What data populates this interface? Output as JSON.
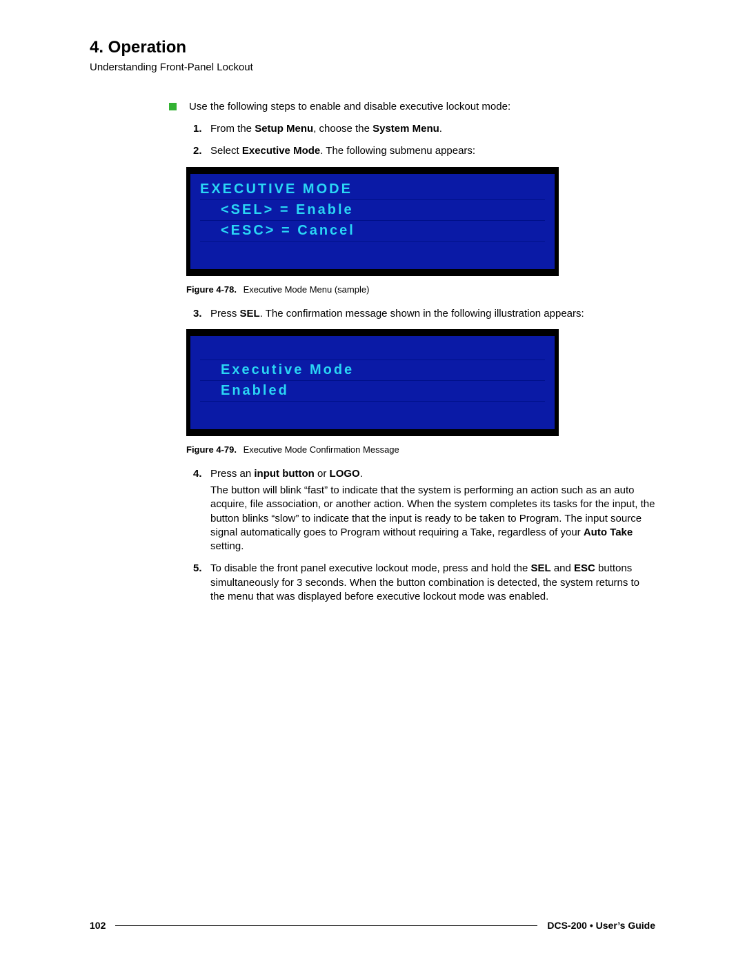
{
  "header": {
    "section_number_title": "4.  Operation",
    "subtitle": "Understanding Front-Panel Lockout"
  },
  "intro_bullet": "Use the following steps to enable and disable executive lockout mode:",
  "steps": {
    "s1_pre": "From the ",
    "s1_b1": "Setup Menu",
    "s1_mid": ", choose the ",
    "s1_b2": "System Menu",
    "s1_post": ".",
    "s2_pre": "Select ",
    "s2_b1": "Executive Mode",
    "s2_post": ". The following submenu appears:",
    "s3_pre": "Press ",
    "s3_b1": "SEL",
    "s3_post": ". The confirmation message shown in the following illustration appears:",
    "s4_pre": "Press an ",
    "s4_b1": "input button",
    "s4_mid": " or ",
    "s4_b2": "LOGO",
    "s4_post": ".",
    "s4_para_a": "The button will blink “fast” to indicate that the system is performing an action such as an auto acquire, file association, or another action. When the system completes its tasks for the input, the button blinks “slow” to indicate that the input is ready to be taken to Program.  The input source signal automatically goes to Program without requiring a Take, regardless of your ",
    "s4_para_b_bold": "Auto Take",
    "s4_para_c": " setting.",
    "s5_a": "To disable the front panel executive lockout mode, press and hold the ",
    "s5_b1": "SEL",
    "s5_b": " and ",
    "s5_b2": "ESC",
    "s5_c": " buttons simultaneously for 3 seconds.  When the button combination is detected, the system returns to the menu that was displayed before executive lockout mode was enabled."
  },
  "lcd1": {
    "line1": "EXECUTIVE MODE",
    "line2": "<SEL> = Enable",
    "line3": "<ESC> = Cancel"
  },
  "fig1": {
    "label": "Figure 4-78.",
    "caption": "Executive Mode Menu (sample)"
  },
  "lcd2": {
    "line1": "Executive Mode",
    "line2": "Enabled"
  },
  "fig2": {
    "label": "Figure 4-79.",
    "caption": "Executive Mode Confirmation Message"
  },
  "footer": {
    "page": "102",
    "guide": "DCS-200 • User’s Guide"
  }
}
